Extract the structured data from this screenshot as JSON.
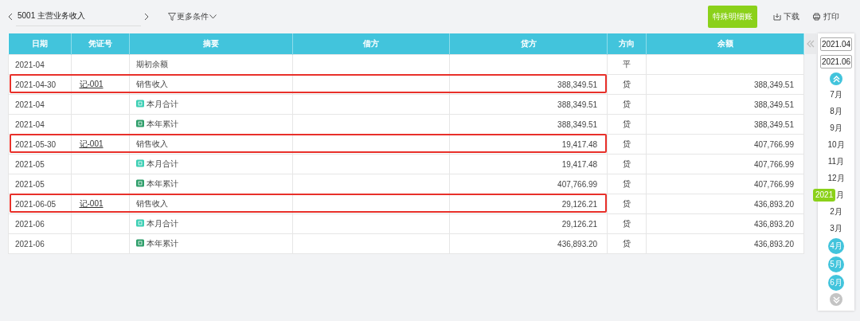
{
  "toolbar": {
    "account": "5001 主营业务收入",
    "filter": "更多条件",
    "special_button": "特殊明细账",
    "download": "下载",
    "print": "打印"
  },
  "table": {
    "columns": [
      "日期",
      "凭证号",
      "摘要",
      "借方",
      "贷方",
      "方向",
      "余额"
    ],
    "rows": [
      {
        "kind": "opening",
        "highlighted": false,
        "date": "2021-04",
        "voucher": "",
        "summary": "期初余额",
        "debit": "",
        "credit": "",
        "direction": "平",
        "balance": ""
      },
      {
        "kind": "entry",
        "highlighted": true,
        "date": "2021-04-30",
        "voucher": "记-001",
        "summary": "销售收入",
        "debit": "",
        "credit": "388,349.51",
        "direction": "贷",
        "balance": "388,349.51"
      },
      {
        "kind": "month_total",
        "highlighted": false,
        "date": "2021-04",
        "voucher": "",
        "summary": "本月合计",
        "debit": "",
        "credit": "388,349.51",
        "direction": "贷",
        "balance": "388,349.51"
      },
      {
        "kind": "year_total",
        "highlighted": false,
        "date": "2021-04",
        "voucher": "",
        "summary": "本年累计",
        "debit": "",
        "credit": "388,349.51",
        "direction": "贷",
        "balance": "388,349.51"
      },
      {
        "kind": "entry",
        "highlighted": true,
        "date": "2021-05-30",
        "voucher": "记-001",
        "summary": "销售收入",
        "debit": "",
        "credit": "19,417.48",
        "direction": "贷",
        "balance": "407,766.99"
      },
      {
        "kind": "month_total",
        "highlighted": false,
        "date": "2021-05",
        "voucher": "",
        "summary": "本月合计",
        "debit": "",
        "credit": "19,417.48",
        "direction": "贷",
        "balance": "407,766.99"
      },
      {
        "kind": "year_total",
        "highlighted": false,
        "date": "2021-05",
        "voucher": "",
        "summary": "本年累计",
        "debit": "",
        "credit": "407,766.99",
        "direction": "贷",
        "balance": "407,766.99"
      },
      {
        "kind": "entry",
        "highlighted": true,
        "date": "2021-06-05",
        "voucher": "记-001",
        "summary": "销售收入",
        "debit": "",
        "credit": "29,126.21",
        "direction": "贷",
        "balance": "436,893.20"
      },
      {
        "kind": "month_total",
        "highlighted": false,
        "date": "2021-06",
        "voucher": "",
        "summary": "本月合计",
        "debit": "",
        "credit": "29,126.21",
        "direction": "贷",
        "balance": "436,893.20"
      },
      {
        "kind": "year_total",
        "highlighted": false,
        "date": "2021-06",
        "voucher": "",
        "summary": "本年累计",
        "debit": "",
        "credit": "436,893.20",
        "direction": "贷",
        "balance": "436,893.20"
      }
    ]
  },
  "period": {
    "start": "2021.04",
    "end": "2021.06",
    "year_badge": "2021",
    "months": [
      {
        "label": "7月",
        "selected": false
      },
      {
        "label": "8月",
        "selected": false
      },
      {
        "label": "9月",
        "selected": false
      },
      {
        "label": "10月",
        "selected": false
      },
      {
        "label": "11月",
        "selected": false
      },
      {
        "label": "12月",
        "selected": false
      },
      {
        "label": "月",
        "selected": false,
        "covered": true
      },
      {
        "label": "2月",
        "selected": false
      },
      {
        "label": "3月",
        "selected": false
      },
      {
        "label": "4月",
        "selected": true
      },
      {
        "label": "5月",
        "selected": true
      },
      {
        "label": "6月",
        "selected": true
      }
    ]
  }
}
